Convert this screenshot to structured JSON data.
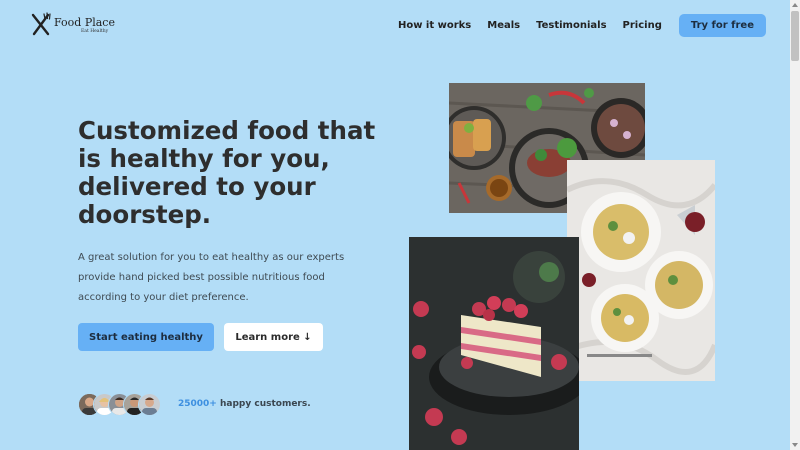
{
  "header": {
    "logo_name": "Food Place",
    "logo_tagline": "Eat Healthy",
    "nav": [
      "How it works",
      "Meals",
      "Testimonials",
      "Pricing"
    ],
    "cta": "Try for free"
  },
  "hero": {
    "headline": "Customized food that is healthy for you, delivered to your doorstep.",
    "description": "A great solution for you to eat healthy as our experts provide hand picked best possible nutritious food according to your diet preference.",
    "primary_button": "Start eating healthy",
    "secondary_button": "Learn more ↓",
    "customer_count": "25000+",
    "customer_text": "happy customers."
  },
  "colors": {
    "background": "#b3ddf7",
    "accent": "#66b0f5",
    "count_highlight": "#3d8fe0"
  }
}
